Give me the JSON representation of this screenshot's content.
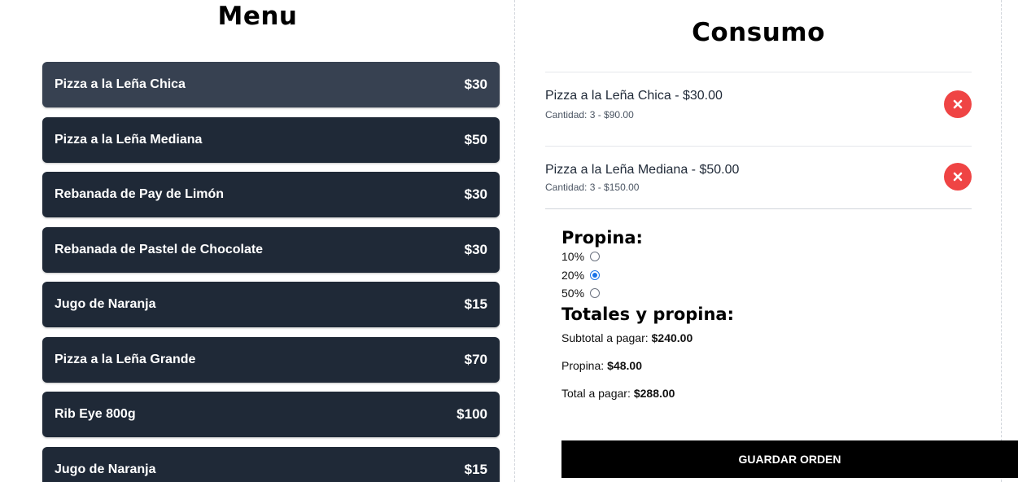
{
  "menu": {
    "title": "Menu",
    "items": [
      {
        "name": "Pizza a la Leña Chica",
        "price": "$30"
      },
      {
        "name": "Pizza a la Leña Mediana",
        "price": "$50"
      },
      {
        "name": "Rebanada de Pay de Limón",
        "price": "$30"
      },
      {
        "name": "Rebanada de Pastel de Chocolate",
        "price": "$30"
      },
      {
        "name": "Jugo de Naranja",
        "price": "$15"
      },
      {
        "name": "Pizza a la Leña Grande",
        "price": "$70"
      },
      {
        "name": "Rib Eye 800g",
        "price": "$100"
      },
      {
        "name": "Jugo de Naranja",
        "price": "$15"
      }
    ]
  },
  "consumo": {
    "title": "Consumo",
    "orders": [
      {
        "name": "Pizza a la Leña Chica - $30.00",
        "detail": "Cantidad: 3 - $90.00",
        "remove_icon": "close-circle-icon"
      },
      {
        "name": "Pizza a la Leña Mediana - $50.00",
        "detail": "Cantidad: 3 - $150.00",
        "remove_icon": "close-circle-icon"
      }
    ]
  },
  "propina": {
    "title": "Propina:",
    "options": [
      {
        "label": "10%",
        "checked": false
      },
      {
        "label": "20%",
        "checked": true
      },
      {
        "label": "50%",
        "checked": false
      }
    ]
  },
  "totales": {
    "title": "Totales y propina:",
    "subtotal_label": "Subtotal a pagar:",
    "subtotal_value": "$240.00",
    "propina_label": "Propina:",
    "propina_value": "$48.00",
    "total_label": "Total a pagar:",
    "total_value": "$288.00"
  },
  "actions": {
    "save_label": "GUARDAR ORDEN"
  },
  "colors": {
    "menu_item_bg": "#1f2937",
    "menu_item_active_bg": "#374151",
    "remove_button": "#ef4444",
    "save_button": "#000000",
    "radio_accent": "#1a73e8"
  }
}
